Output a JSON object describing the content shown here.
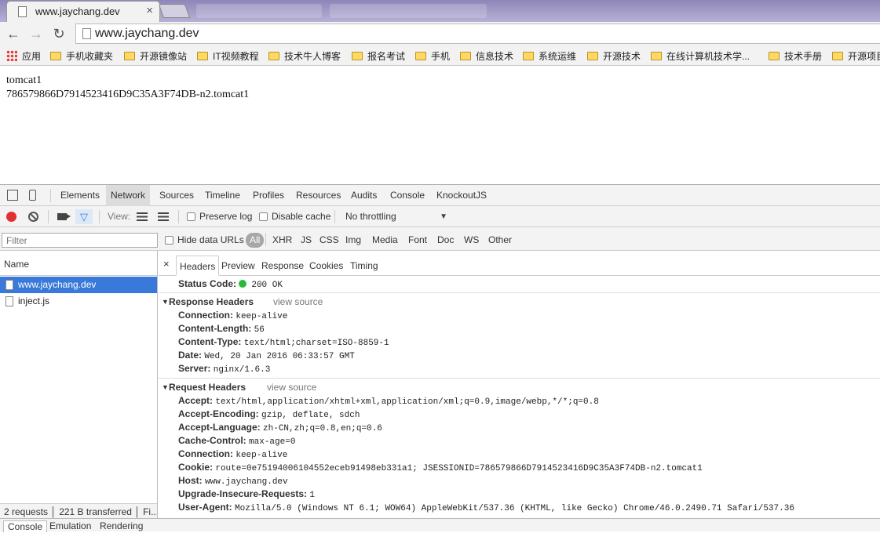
{
  "browser": {
    "tab_title": "www.jaychang.dev",
    "tab_close": "×",
    "back_icon": "←",
    "forward_icon": "→",
    "reload_icon": "↻",
    "url": "www.jaychang.dev"
  },
  "bookmarks": {
    "apps_label": "应用",
    "items": [
      "手机收藏夹",
      "开源镜像站",
      "IT视频教程",
      "技术牛人博客",
      "报名考试",
      "手机",
      "信息技术",
      "系统运维",
      "开源技术",
      "在线计算机技术学...",
      "技术手册",
      "开源项目"
    ]
  },
  "page": {
    "line1": "tomcat1",
    "line2": "786579866D7914523416D9C35A3F74DB-n2.tomcat1"
  },
  "devtools": {
    "tabs": [
      "Elements",
      "Network",
      "Sources",
      "Timeline",
      "Profiles",
      "Resources",
      "Audits",
      "Console",
      "KnockoutJS"
    ],
    "active_tab": "Network",
    "toolbar": {
      "view_label": "View:",
      "preserve_log": "Preserve log",
      "disable_cache": "Disable cache",
      "throttling": "No throttling",
      "throttle_arrow": "▼"
    },
    "filter": {
      "placeholder": "Filter",
      "hide_data_urls": "Hide data URLs",
      "types": [
        "All",
        "XHR",
        "JS",
        "CSS",
        "Img",
        "Media",
        "Font",
        "Doc",
        "WS",
        "Other"
      ]
    },
    "requests": {
      "header": "Name",
      "rows": [
        "www.jaychang.dev",
        "inject.js"
      ],
      "status": "2 requests │ 221 B transferred │ Fi..."
    },
    "detail": {
      "close": "×",
      "tabs": [
        "Headers",
        "Preview",
        "Response",
        "Cookies",
        "Timing"
      ],
      "status_code_key": "Status Code:",
      "status_code_value": "200 OK",
      "response_headers_title": "Response Headers",
      "request_headers_title": "Request Headers",
      "view_source": "view source",
      "response_headers": [
        {
          "k": "Connection:",
          "v": "keep-alive"
        },
        {
          "k": "Content-Length:",
          "v": "56"
        },
        {
          "k": "Content-Type:",
          "v": "text/html;charset=ISO-8859-1"
        },
        {
          "k": "Date:",
          "v": "Wed, 20 Jan 2016 06:33:57 GMT"
        },
        {
          "k": "Server:",
          "v": "nginx/1.6.3"
        }
      ],
      "request_headers": [
        {
          "k": "Accept:",
          "v": "text/html,application/xhtml+xml,application/xml;q=0.9,image/webp,*/*;q=0.8"
        },
        {
          "k": "Accept-Encoding:",
          "v": "gzip, deflate, sdch"
        },
        {
          "k": "Accept-Language:",
          "v": "zh-CN,zh;q=0.8,en;q=0.6"
        },
        {
          "k": "Cache-Control:",
          "v": "max-age=0"
        },
        {
          "k": "Connection:",
          "v": "keep-alive"
        },
        {
          "k": "Cookie:",
          "v": "route=0e75194006104552eceb91498eb331a1; JSESSIONID=786579866D7914523416D9C35A3F74DB-n2.tomcat1"
        },
        {
          "k": "Host:",
          "v": "www.jaychang.dev"
        },
        {
          "k": "Upgrade-Insecure-Requests:",
          "v": "1"
        },
        {
          "k": "User-Agent:",
          "v": "Mozilla/5.0 (Windows NT 6.1; WOW64) AppleWebKit/537.36 (KHTML, like Gecko) Chrome/46.0.2490.71 Safari/537.36"
        }
      ]
    },
    "drawer_tabs": [
      "Console",
      "Emulation",
      "Rendering"
    ]
  }
}
